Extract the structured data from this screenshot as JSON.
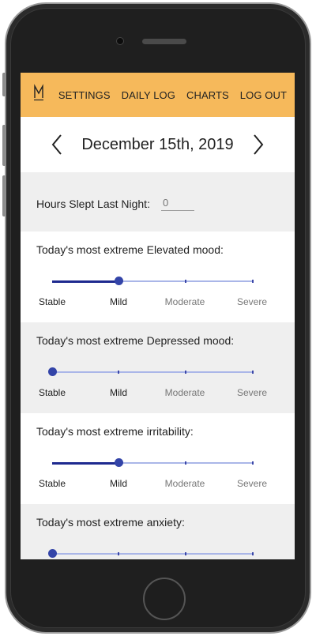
{
  "nav": {
    "logo_text": "M",
    "items": [
      "SETTINGS",
      "DAILY LOG",
      "CHARTS",
      "LOG OUT"
    ]
  },
  "date": {
    "text": "December 15th, 2019"
  },
  "sleep": {
    "label": "Hours Slept Last Night:",
    "placeholder": "0"
  },
  "scale_labels": [
    "Stable",
    "Mild",
    "Moderate",
    "Severe"
  ],
  "sections": [
    {
      "title": "Today's most extreme Elevated mood:",
      "value": "Mild"
    },
    {
      "title": "Today's most extreme Depressed mood:",
      "value": "Stable"
    },
    {
      "title": "Today's most extreme irritability:",
      "value": "Mild"
    },
    {
      "title": "Today's most extreme anxiety:",
      "value": "Stable"
    }
  ],
  "colors": {
    "header": "#f6b95b",
    "slider_active": "#1e2a8f",
    "slider_thumb": "#3344a8",
    "slider_track": "#aab6e8"
  }
}
